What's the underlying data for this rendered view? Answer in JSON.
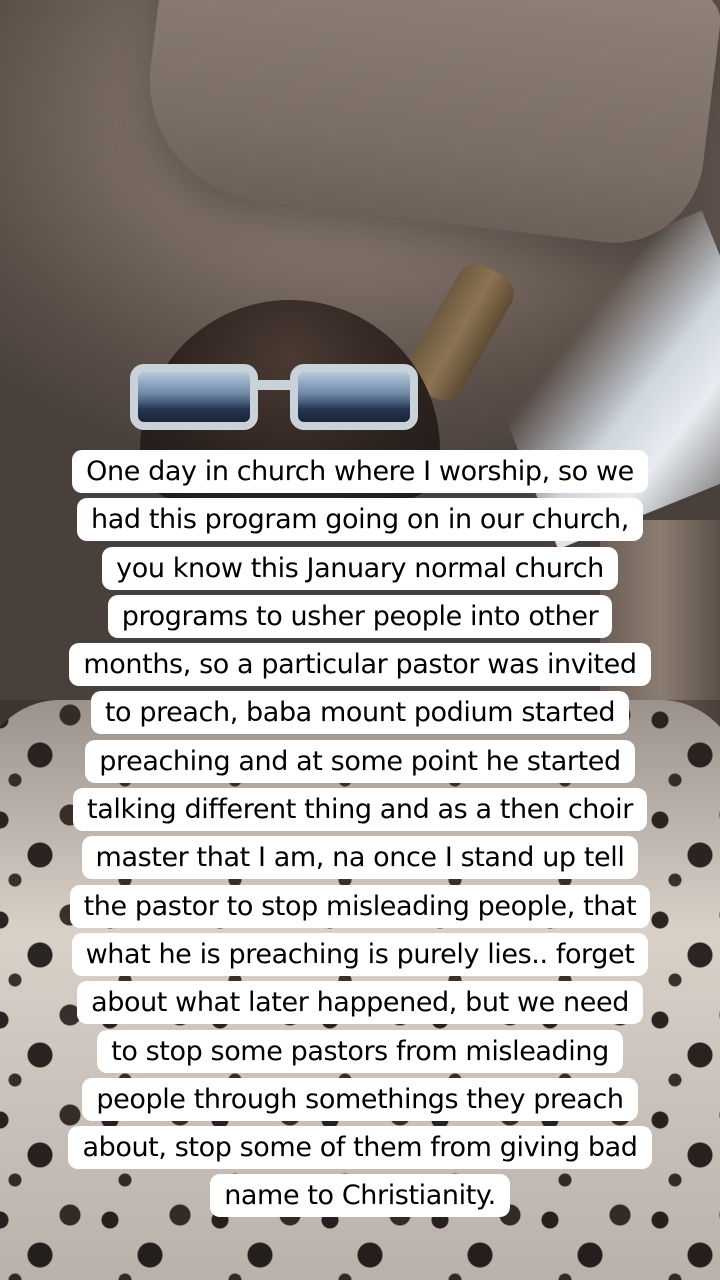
{
  "caption": {
    "lines": [
      "One day in church where I worship, so we",
      "had this program going on in our church,",
      "you know this January normal church",
      "programs to usher people into other",
      "months, so a particular pastor was invited",
      "to preach, baba mount podium started",
      "preaching and at some point he started",
      "talking different thing and as a then choir",
      "master that I am, na once I stand up tell",
      "the pastor to stop misleading people, that",
      "what he is preaching is purely lies.. forget",
      "about what later happened, but we need",
      "to stop some pastors from misleading",
      "people through somethings they preach",
      "about, stop some of them from giving bad",
      "name to Christianity."
    ]
  },
  "colors": {
    "caption_background": "#ffffff",
    "caption_text": "#000000"
  }
}
